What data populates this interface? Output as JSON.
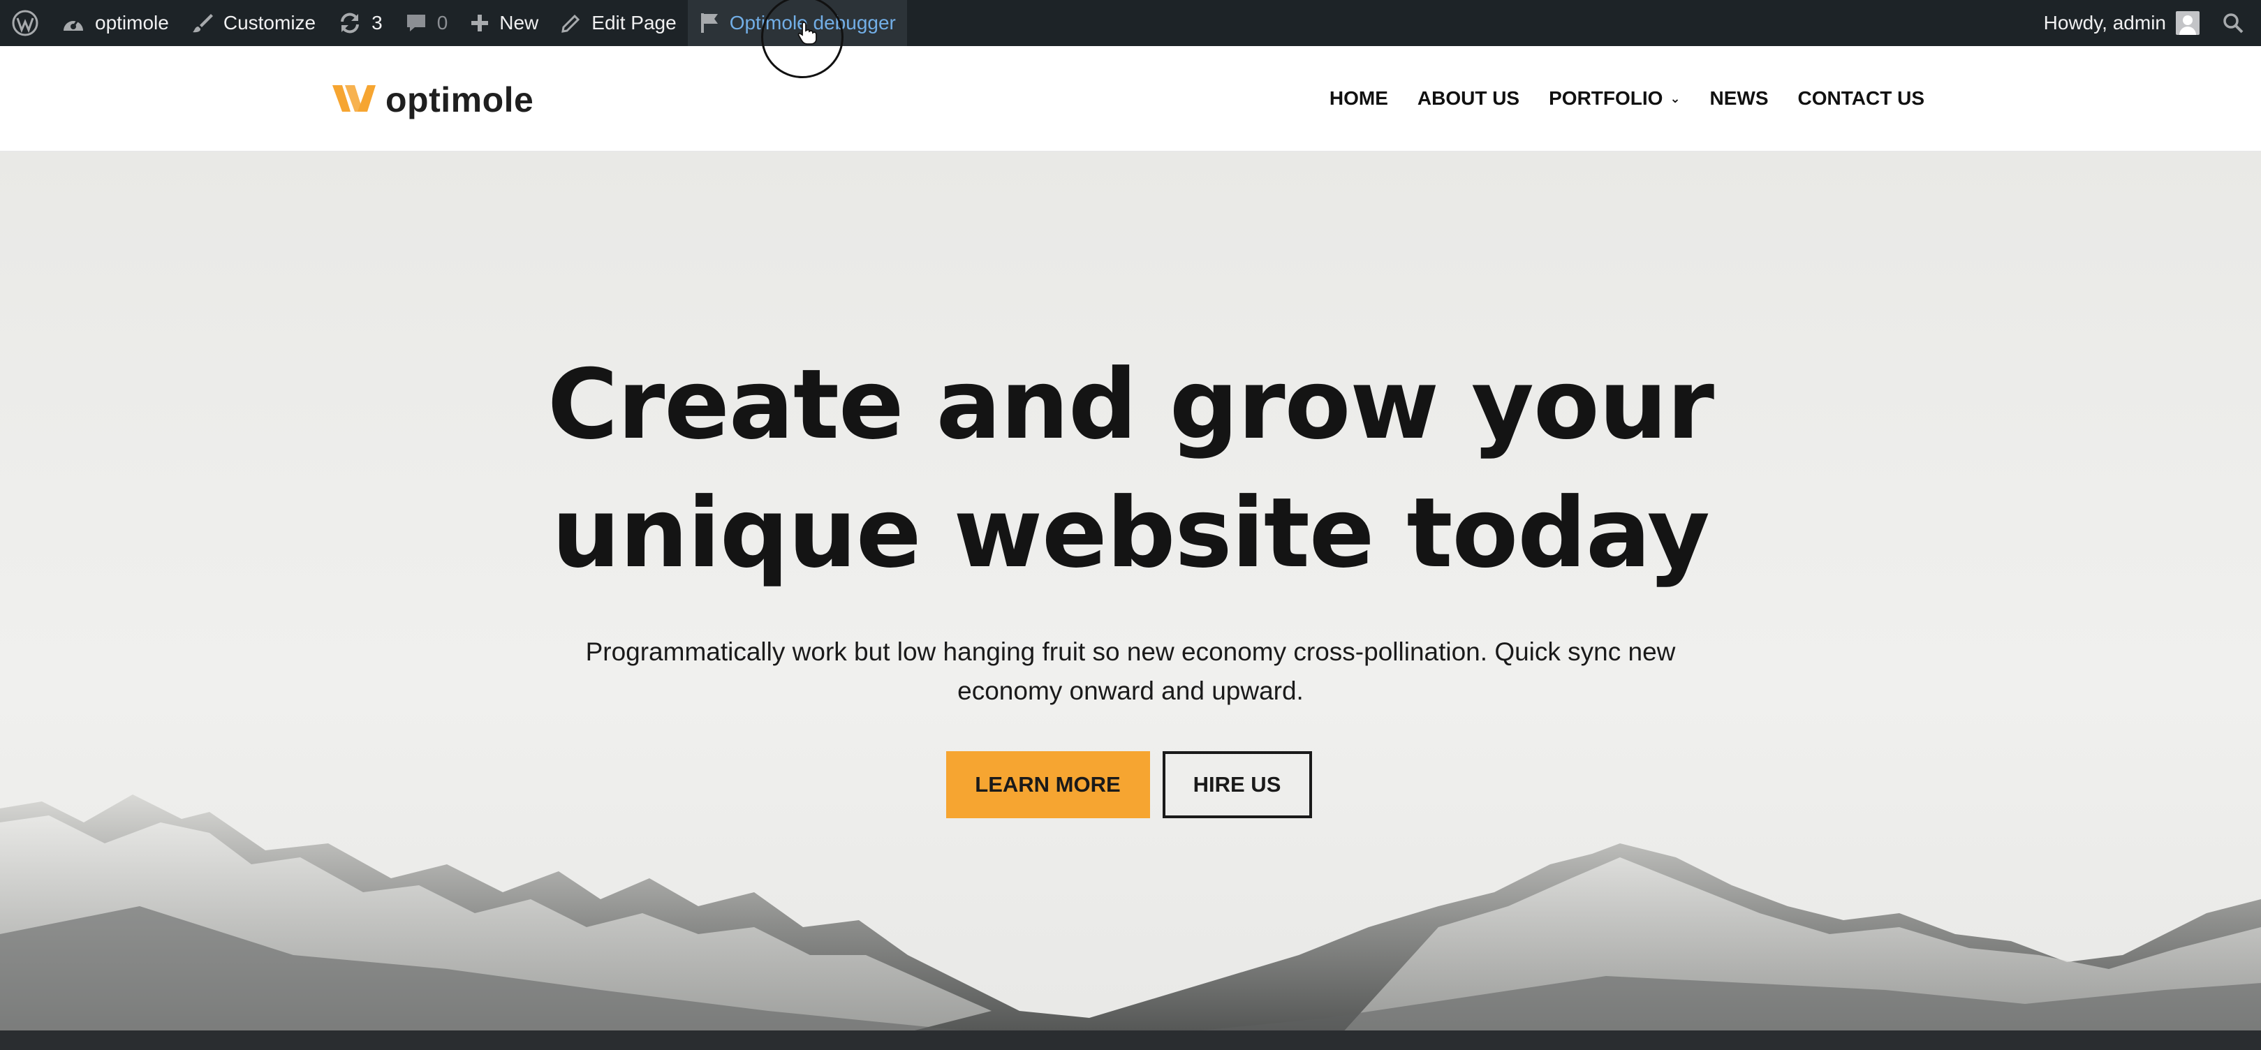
{
  "adminbar": {
    "wp_logo": "wordpress-icon",
    "site_name": "optimole",
    "customize": "Customize",
    "updates_count": "3",
    "comments_count": "0",
    "new_label": "New",
    "edit_page": "Edit Page",
    "debugger": "Optimole debugger",
    "howdy": "Howdy, admin"
  },
  "header": {
    "logo_text": "optimole",
    "logo_color": "#f6a531",
    "nav": [
      "HOME",
      "ABOUT US",
      "PORTFOLIO",
      "NEWS",
      "CONTACT US"
    ]
  },
  "hero": {
    "title_line1": "Create and grow your",
    "title_line2": "unique website today",
    "sub_line1": "Programmatically work but low hanging fruit so new economy cross-pollination. Quick sync new",
    "sub_line2": "economy onward and upward.",
    "primary_button": "LEARN MORE",
    "secondary_button": "HIRE US"
  },
  "colors": {
    "adminbar_bg": "#1d2327",
    "accent": "#f6a531",
    "active_link": "#72aee6"
  }
}
